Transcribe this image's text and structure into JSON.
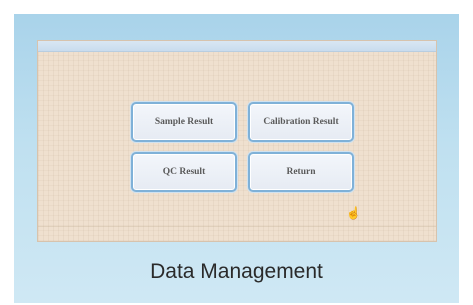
{
  "screen": {
    "title": "",
    "datetime": "",
    "buttons": {
      "sample_result": "Sample Result",
      "calibration_result": "Calibration Result",
      "qc_result": "QC Result",
      "return": "Return"
    },
    "cursor_icon": "pointer-cursor-icon"
  },
  "caption": "Data Management",
  "colors": {
    "frame_top": "#a9d3ea",
    "frame_bottom": "#cfe8f4",
    "screen_bg": "#efe0cf",
    "button_border": "#7fb1d8",
    "button_text": "#5a5a5a"
  }
}
